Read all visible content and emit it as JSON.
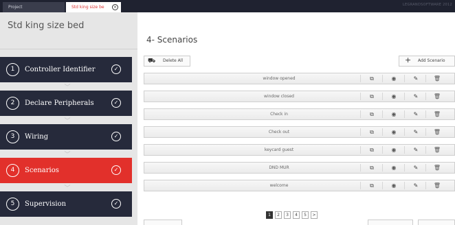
{
  "topbar": {
    "tabs": [
      {
        "label": "Project"
      },
      {
        "label": "Std king size be"
      }
    ],
    "close_glyph": "⊗",
    "brand": "LEGRANDSOFTWARE 2012"
  },
  "sidebar": {
    "title": "Std king size bed",
    "steps": [
      {
        "number": "1",
        "label": "Controller Identifier",
        "check": "✓"
      },
      {
        "number": "2",
        "label": "Declare Peripherals",
        "check": "✓"
      },
      {
        "number": "3",
        "label": "Wiring",
        "check": "✓"
      },
      {
        "number": "4",
        "label": "Scenarios",
        "check": "✓"
      },
      {
        "number": "5",
        "label": "Supervision",
        "check": "✓"
      }
    ],
    "chevron": "﹀"
  },
  "main": {
    "title": "4- Scenarios",
    "delete_all": {
      "icon": "delete-all-icon",
      "glyph": "⛟",
      "label": "Delete All"
    },
    "add_scenario": {
      "icon": "plus-icon",
      "glyph": "+",
      "label": "Add Scenario"
    },
    "scenarios": [
      {
        "name": "window opened"
      },
      {
        "name": "window closed"
      },
      {
        "name": "Check in"
      },
      {
        "name": "Check out"
      },
      {
        "name": "keycard guest"
      },
      {
        "name": "DND MUR"
      },
      {
        "name": "welcome"
      }
    ],
    "row_actions": {
      "copy": {
        "icon": "copy-icon",
        "glyph": "⧉"
      },
      "view": {
        "icon": "eye-icon",
        "glyph": "◉"
      },
      "edit": {
        "icon": "pencil-icon",
        "glyph": "✎"
      },
      "delete": {
        "icon": "trash-icon",
        "glyph": "🗑"
      }
    },
    "pagination": {
      "pages": [
        "1",
        "2",
        "3",
        "4",
        "5"
      ],
      "current": "1",
      "next": ">"
    }
  },
  "colors": {
    "topbar": "#1f2230",
    "step_bg": "#262a3b",
    "step_active": "#e2302b",
    "sidebar_bg": "#e6e6e6"
  }
}
